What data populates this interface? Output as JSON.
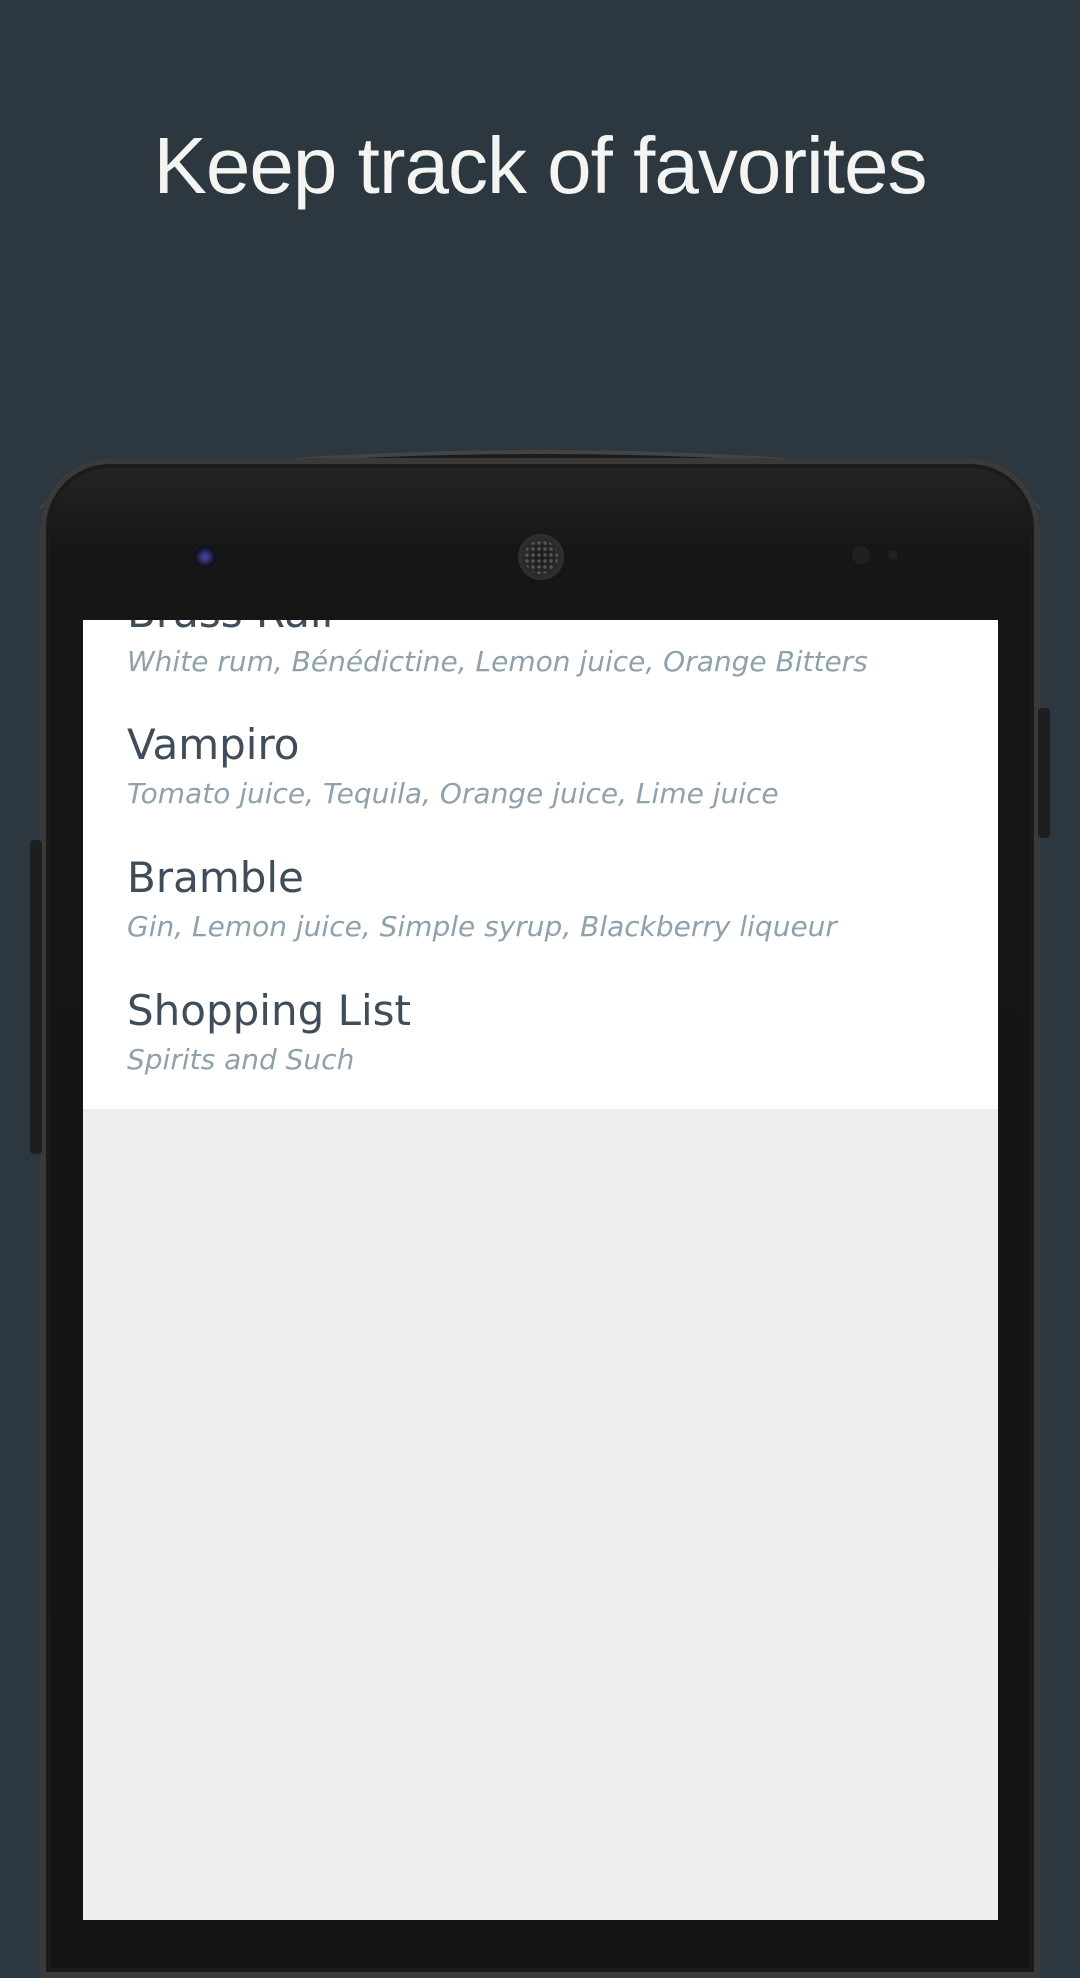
{
  "headline": "Keep track of favorites",
  "favorites": [
    {
      "title": "Brass Rail",
      "subtitle": "White rum, Bénédictine, Lemon juice, Orange Bitters"
    },
    {
      "title": "Vampiro",
      "subtitle": "Tomato juice, Tequila, Orange juice, Lime juice"
    },
    {
      "title": "Bramble",
      "subtitle": "Gin, Lemon juice, Simple syrup, Blackberry liqueur"
    },
    {
      "title": "Shopping List",
      "subtitle": "Spirits and Such"
    }
  ],
  "colors": {
    "background": "#2c3740",
    "headline": "#f4f4f2",
    "item_title": "#3f4d5b",
    "item_subtitle": "#8fa1ad",
    "list_background": "#ffffff",
    "screen_empty": "#eeeeee"
  },
  "icons": [
    "front-camera-icon",
    "earpiece-speaker-icon",
    "proximity-sensor-icon"
  ]
}
